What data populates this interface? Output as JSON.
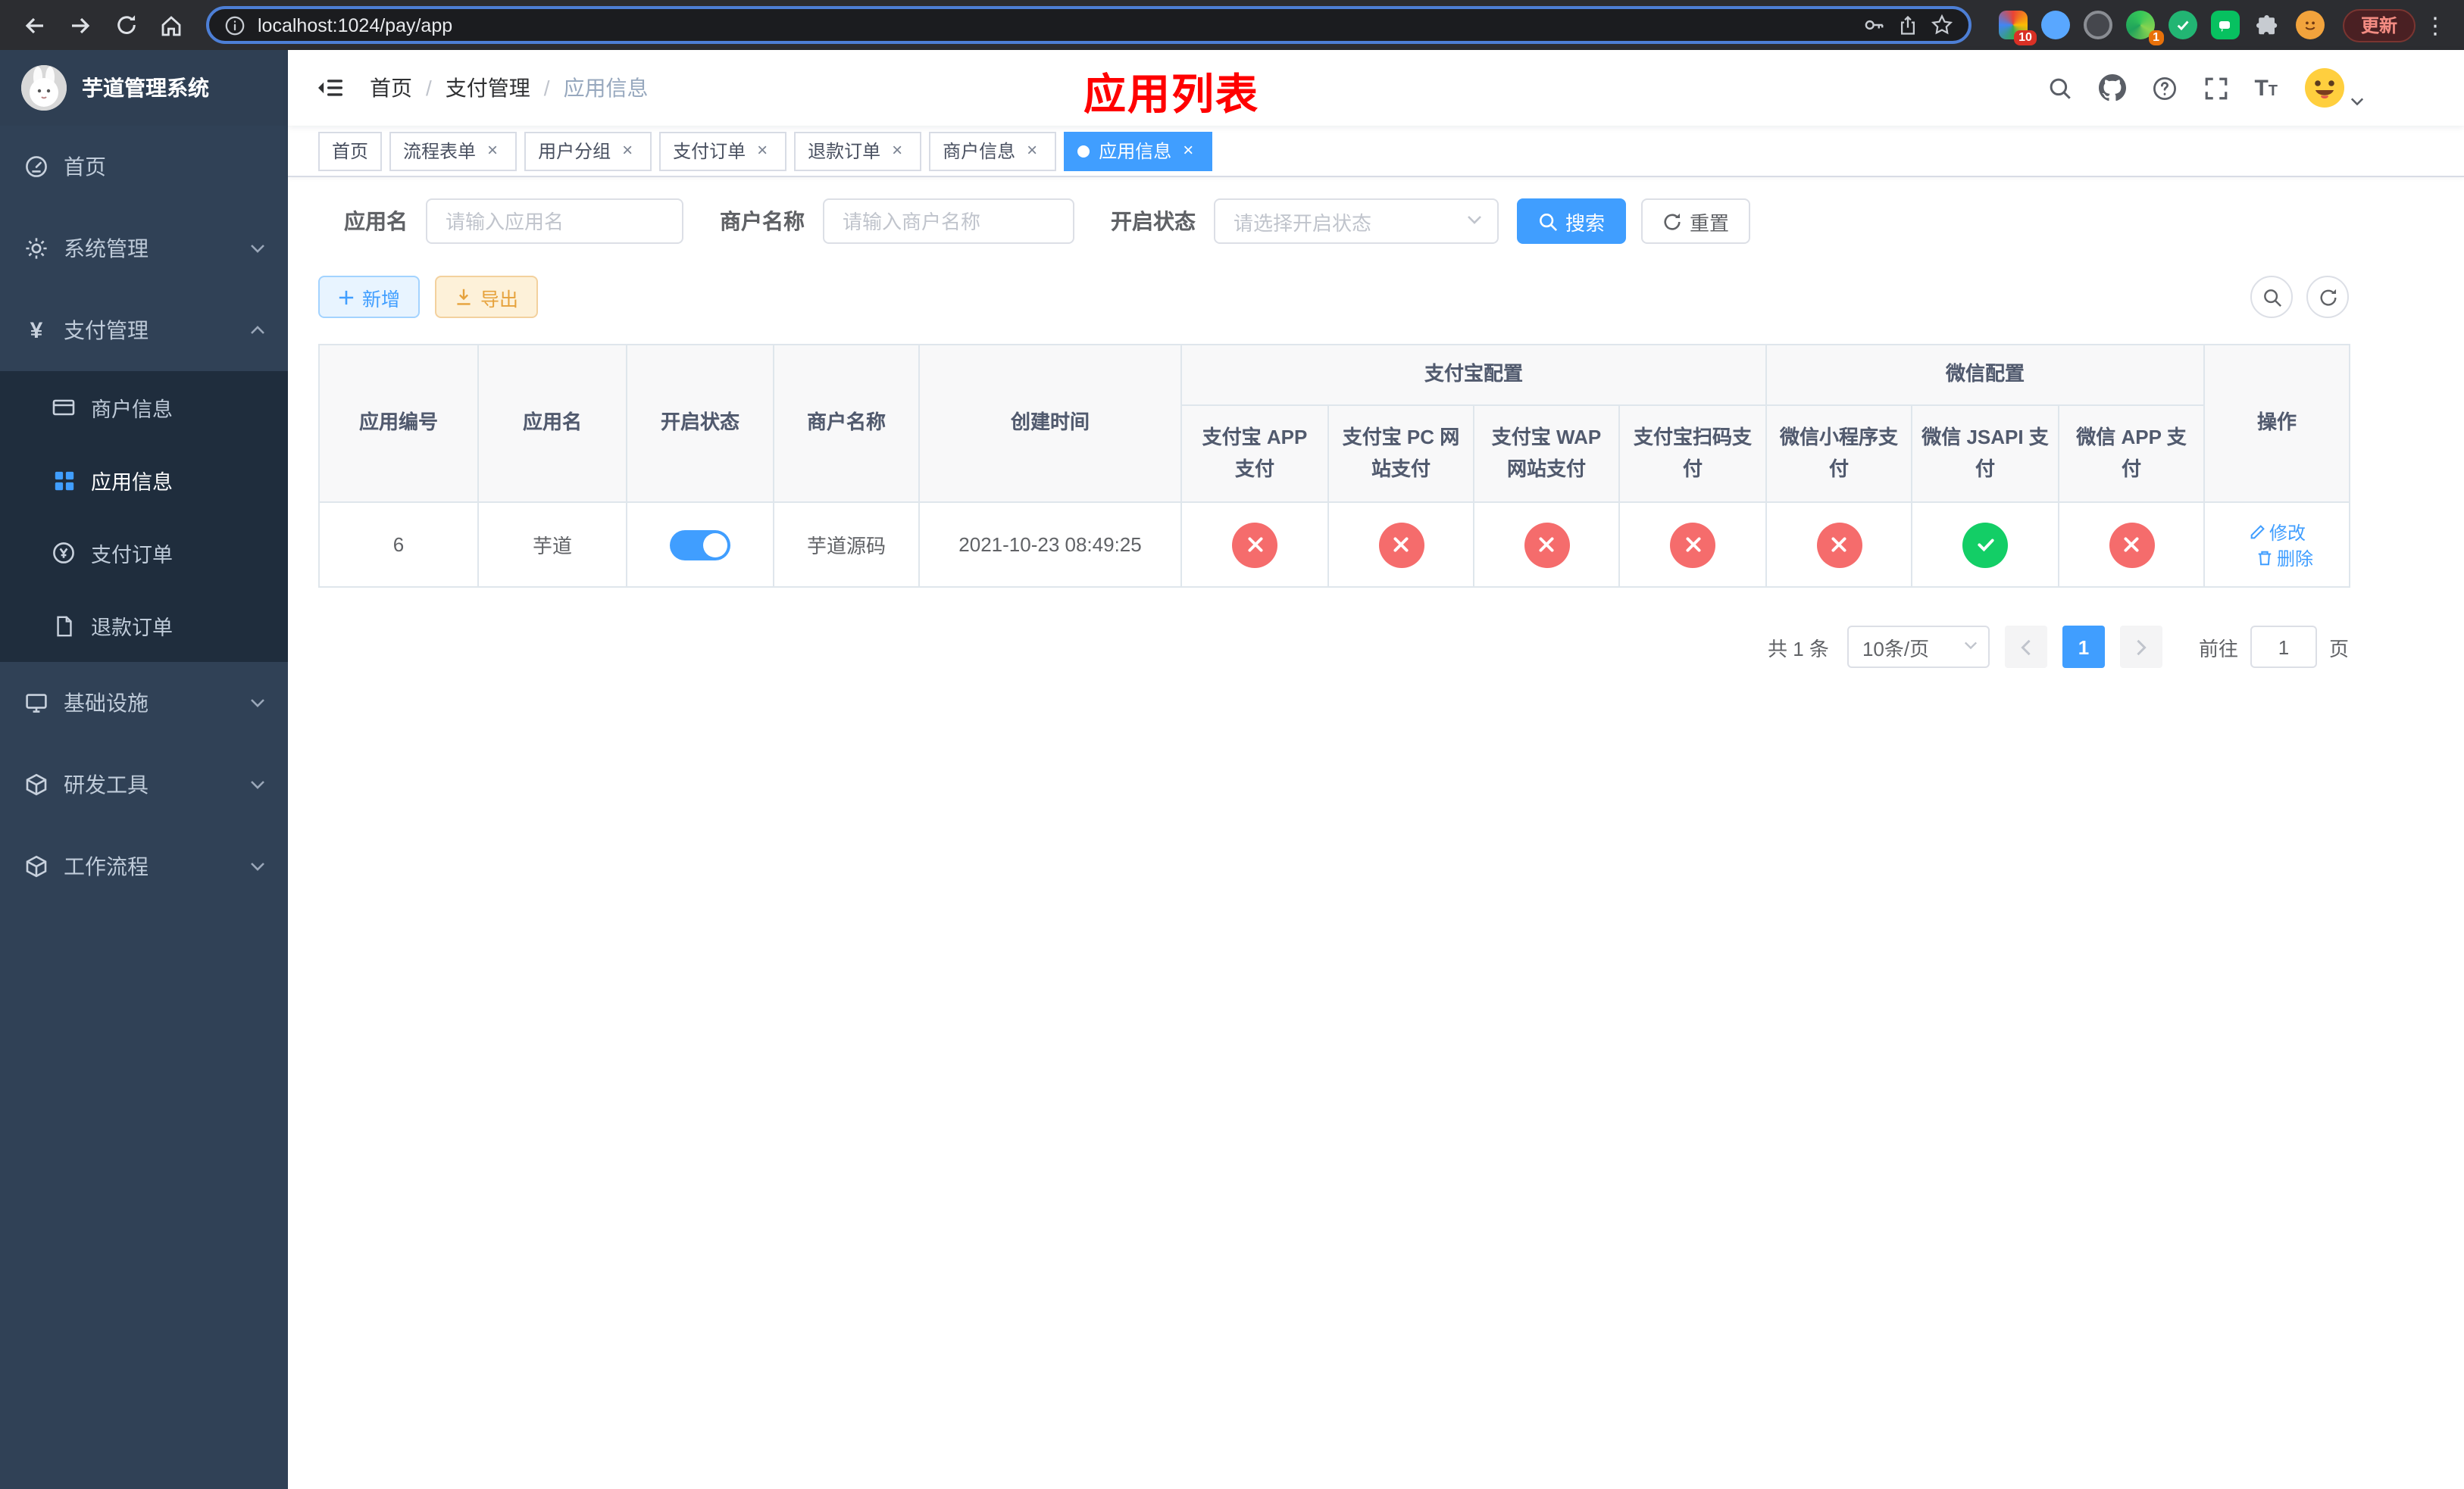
{
  "browser": {
    "url": "localhost:1024/pay/app",
    "update_label": "更新",
    "extensions_badge": "10",
    "profile_badge": "1"
  },
  "sidebar": {
    "title": "芋道管理系统",
    "menu": [
      {
        "label": "首页"
      },
      {
        "label": "系统管理"
      },
      {
        "label": "支付管理"
      },
      {
        "label": "基础设施"
      },
      {
        "label": "研发工具"
      },
      {
        "label": "工作流程"
      }
    ],
    "payment_submenu": [
      {
        "label": "商户信息"
      },
      {
        "label": "应用信息"
      },
      {
        "label": "支付订单"
      },
      {
        "label": "退款订单"
      }
    ]
  },
  "header": {
    "breadcrumb": [
      "首页",
      "支付管理",
      "应用信息"
    ],
    "separator": "/",
    "page_title": "应用列表"
  },
  "tabs": [
    {
      "label": "首页"
    },
    {
      "label": "流程表单"
    },
    {
      "label": "用户分组"
    },
    {
      "label": "支付订单"
    },
    {
      "label": "退款订单"
    },
    {
      "label": "商户信息"
    },
    {
      "label": "应用信息"
    }
  ],
  "filters": {
    "app_name_label": "应用名",
    "app_name_placeholder": "请输入应用名",
    "merchant_label": "商户名称",
    "merchant_placeholder": "请输入商户名称",
    "status_label": "开启状态",
    "status_placeholder": "请选择开启状态",
    "search_label": "搜索",
    "reset_label": "重置"
  },
  "toolbar": {
    "add_label": "新增",
    "export_label": "导出"
  },
  "table": {
    "col_app_id": "应用编号",
    "col_app_name": "应用名",
    "col_status": "开启状态",
    "col_merchant": "商户名称",
    "col_created": "创建时间",
    "group_alipay": "支付宝配置",
    "group_wechat": "微信配置",
    "col_actions": "操作",
    "sub_columns": [
      "支付宝 APP 支付",
      "支付宝 PC 网站支付",
      "支付宝 WAP 网站支付",
      "支付宝扫码支付",
      "微信小程序支付",
      "微信 JSAPI 支付",
      "微信 APP 支付"
    ],
    "row": {
      "app_id": "6",
      "app_name": "芋道",
      "status_on": true,
      "merchant": "芋道源码",
      "created": "2021-10-23 08:49:25",
      "channel_status": [
        "error",
        "error",
        "error",
        "error",
        "error",
        "success",
        "error"
      ],
      "edit_label": "修改",
      "delete_label": "删除"
    }
  },
  "pagination": {
    "total": "共 1 条",
    "page_size": "10条/页",
    "current_page": "1",
    "goto_label": "前往",
    "goto_value": "1",
    "page_unit": "页"
  },
  "colors": {
    "primary": "#409eff",
    "success": "#13ce66",
    "danger": "#f56c6c",
    "title-red": "#ff0000"
  }
}
